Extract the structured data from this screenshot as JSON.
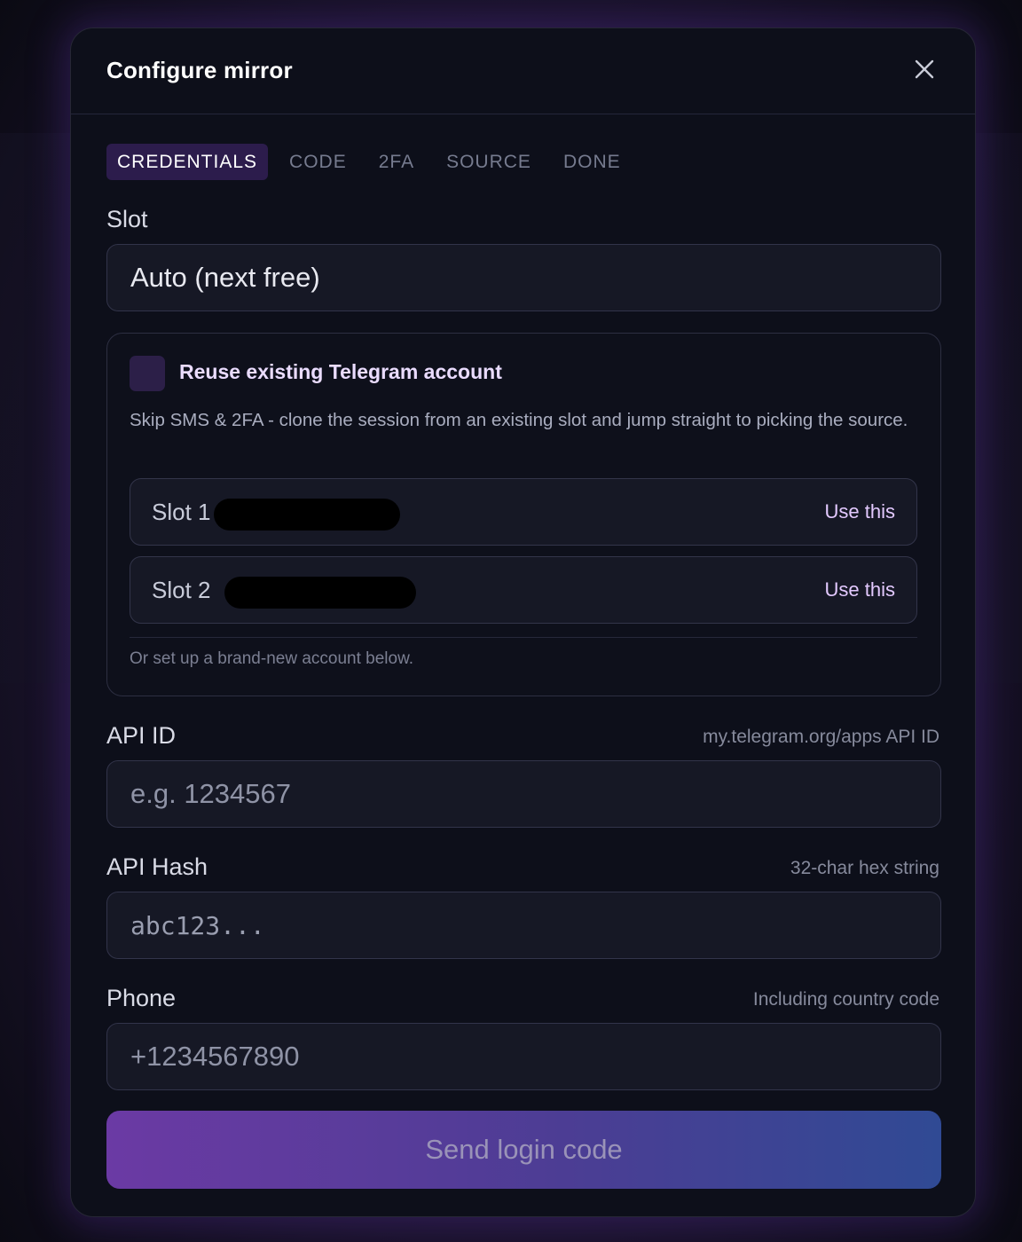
{
  "dialog": {
    "title": "Configure mirror"
  },
  "tabs": [
    {
      "label": "CREDENTIALS",
      "active": true
    },
    {
      "label": "CODE",
      "active": false
    },
    {
      "label": "2FA",
      "active": false
    },
    {
      "label": "SOURCE",
      "active": false
    },
    {
      "label": "DONE",
      "active": false
    }
  ],
  "slot": {
    "label": "Slot",
    "value": "Auto (next free)"
  },
  "reuse": {
    "checked": false,
    "title": "Reuse existing Telegram account",
    "description": "Skip SMS & 2FA - clone the session from an existing slot and jump straight to picking the source.",
    "slots": [
      {
        "label": "Slot 1",
        "action": "Use this"
      },
      {
        "label": "Slot 2",
        "action": "Use this"
      }
    ],
    "footnote": "Or set up a brand-new account below."
  },
  "api_id": {
    "label": "API ID",
    "hint": "my.telegram.org/apps API ID",
    "placeholder": "e.g. 1234567",
    "value": ""
  },
  "api_hash": {
    "label": "API Hash",
    "hint": "32-char hex string",
    "placeholder": "abc123...",
    "value": ""
  },
  "phone": {
    "label": "Phone",
    "hint": "Including country code",
    "placeholder": "+1234567890",
    "value": ""
  },
  "submit": {
    "label": "Send login code"
  },
  "icons": {
    "close": "close-icon"
  },
  "colors": {
    "accent": "#2c1c4c",
    "accent_text": "#e3c9ff",
    "button_gradient_start": "#6b3aa4",
    "button_gradient_end": "#304a94"
  }
}
